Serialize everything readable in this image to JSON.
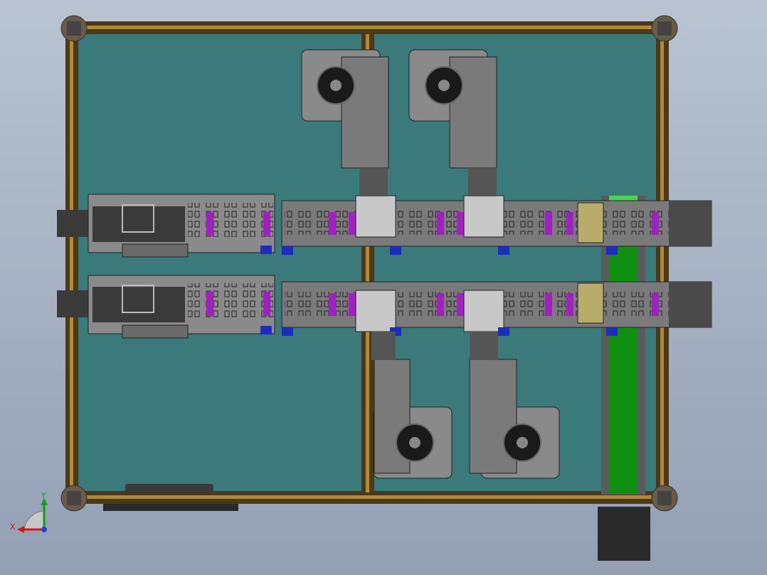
{
  "view": {
    "background": "#a3aebf",
    "plate_color": "#3a7a7a",
    "frame_color": "#4a3a1a",
    "frame_inner": "#b08a3a",
    "conveyor_green": "#109010",
    "gripper_purple": "#a020c0",
    "sensor_blue": "#1c2cc0",
    "part_dark": "#3a3a3a",
    "part_gray": "#8a8a8a",
    "part_light": "#bdbdbd",
    "bracket_tan": "#b8ac6a"
  },
  "triad": {
    "x_label": "X",
    "y_label": "Y",
    "x_color": "#e01010",
    "y_color": "#10a010",
    "z_color": "#2040e0"
  },
  "assembly": {
    "frame": {
      "corner_mounts": 4,
      "center_divider": true
    },
    "feeders": 2,
    "linear_modules": 2,
    "motor_units": 4,
    "side_conveyor": true
  }
}
